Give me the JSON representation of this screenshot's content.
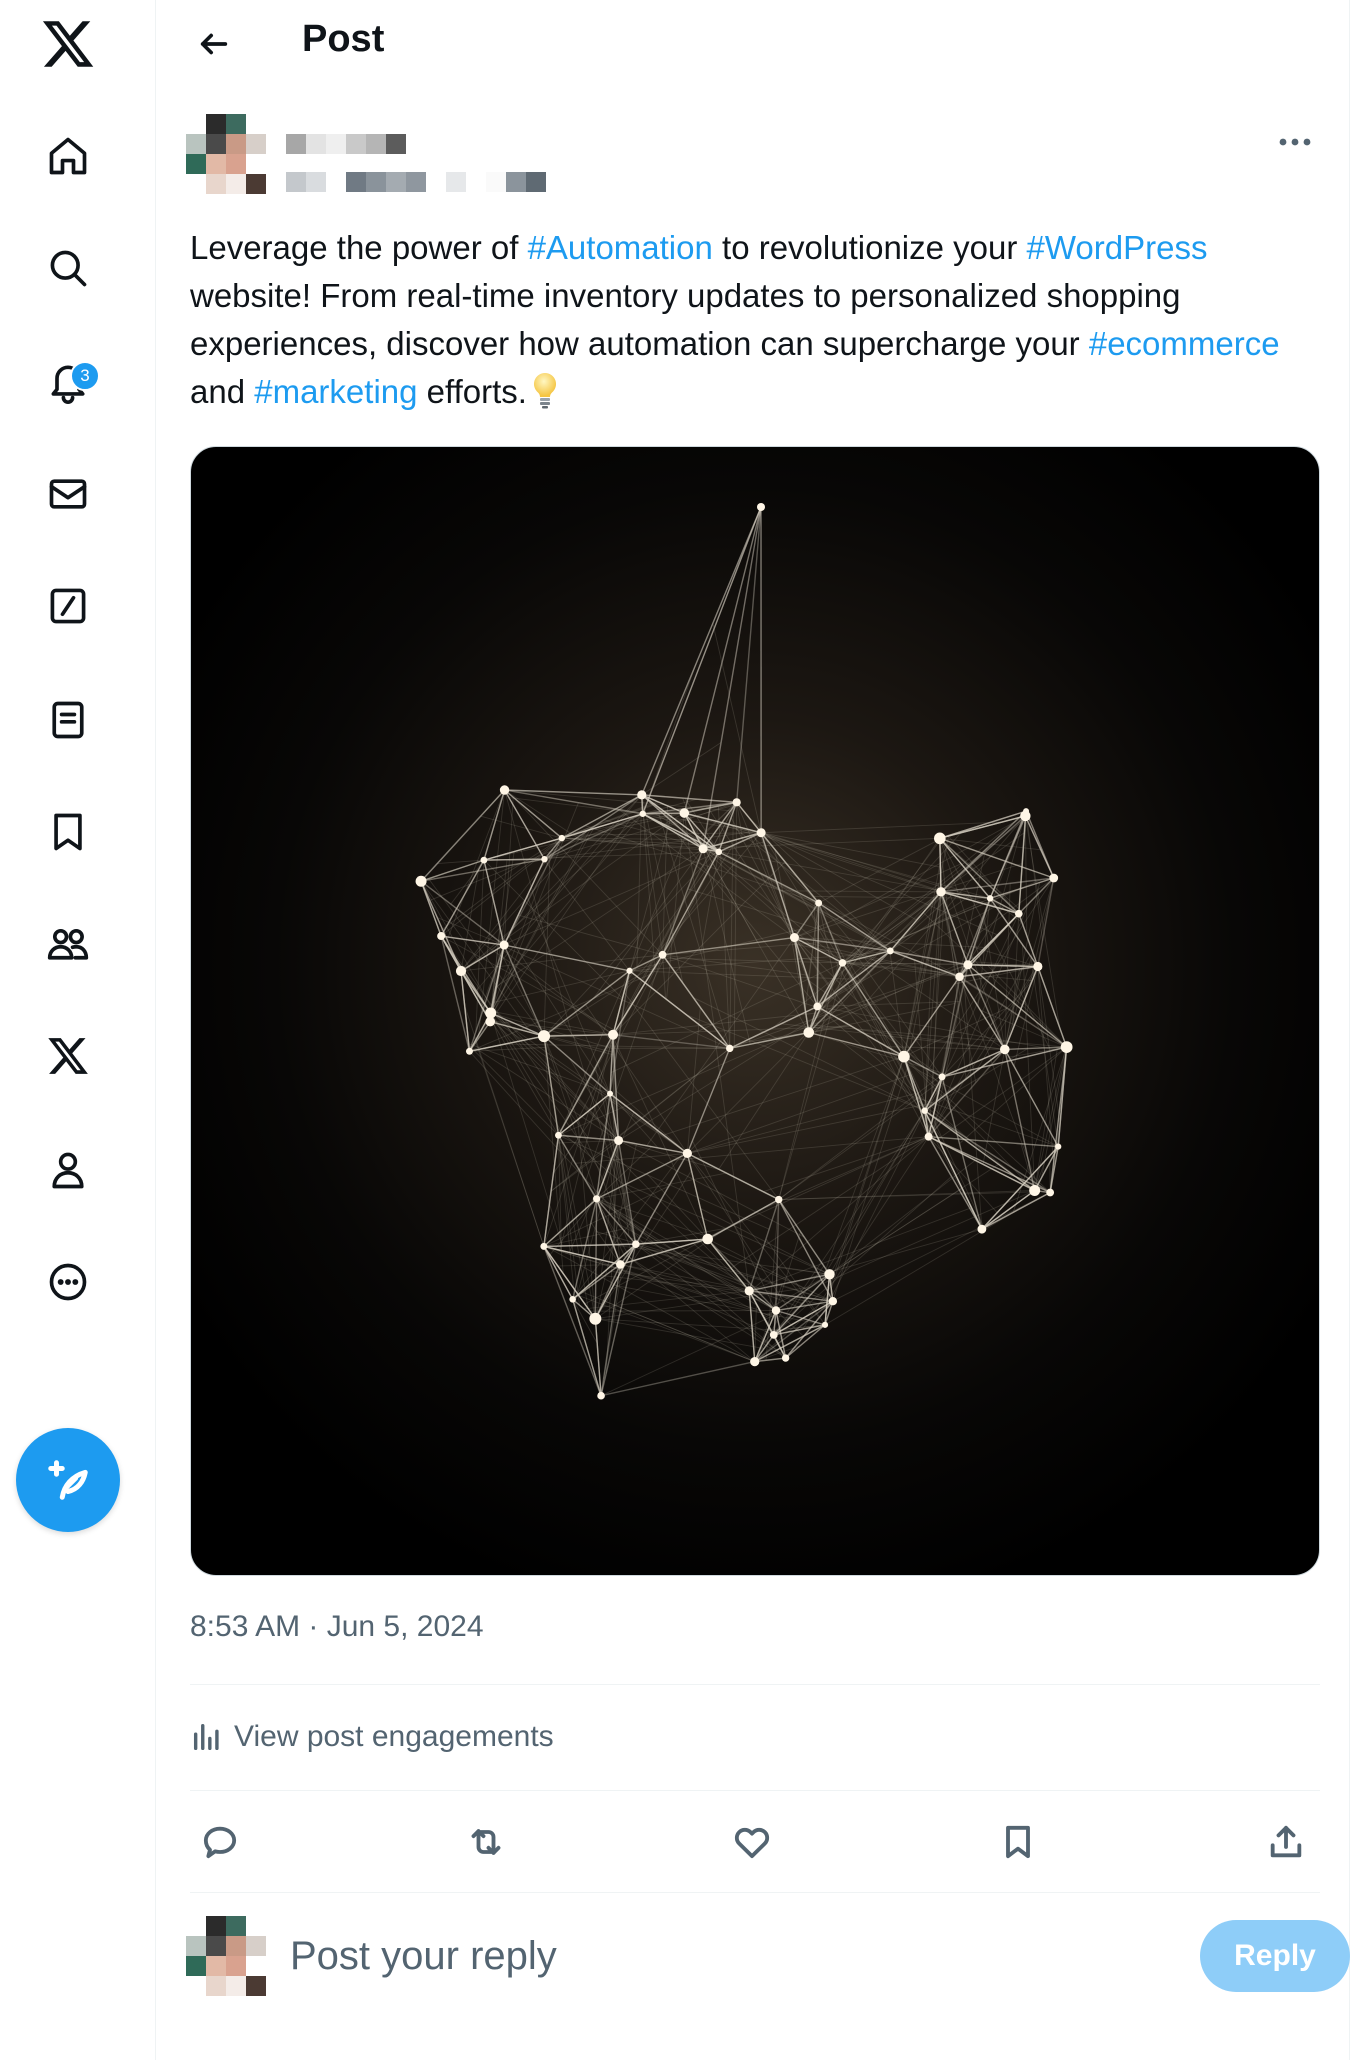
{
  "sidebar": {
    "logo_icon": "x-logo-icon",
    "items": [
      {
        "id": "home",
        "icon": "home-icon"
      },
      {
        "id": "explore",
        "icon": "search-icon"
      },
      {
        "id": "notifications",
        "icon": "bell-icon",
        "badge": "3"
      },
      {
        "id": "messages",
        "icon": "envelope-icon"
      },
      {
        "id": "grok",
        "icon": "slash-square-icon"
      },
      {
        "id": "lists",
        "icon": "list-icon"
      },
      {
        "id": "bookmarks",
        "icon": "bookmark-icon"
      },
      {
        "id": "communities",
        "icon": "people-icon"
      },
      {
        "id": "premium",
        "icon": "x-icon"
      },
      {
        "id": "profile",
        "icon": "person-icon"
      },
      {
        "id": "more",
        "icon": "more-circle-icon"
      }
    ],
    "compose_icon": "feather-plus-icon"
  },
  "header": {
    "title": "Post",
    "back_icon": "arrow-left-icon"
  },
  "post": {
    "text": {
      "part1": "Leverage the power of ",
      "tag1": "#Automation",
      "part2": " to revolutionize your ",
      "tag2": "#WordPress",
      "part3": " website! From real-time inventory updates to personalized shopping experiences, discover how automation can supercharge your ",
      "tag3": "#ecommerce",
      "part4": " and ",
      "tag4": "#marketing",
      "part5": " efforts."
    },
    "emoji_icon": "lightbulb-icon",
    "timestamp": "8:53 AM · Jun 5, 2024",
    "engagements_label": "View post engagements",
    "engagements_icon": "bar-chart-icon",
    "actions": [
      "reply-icon",
      "repost-icon",
      "like-icon",
      "bookmark-icon",
      "share-icon"
    ]
  },
  "reply": {
    "placeholder": "Post your reply",
    "button_label": "Reply"
  },
  "colors": {
    "accent": "#1d9bf0",
    "reply_button_disabled": "#8ecdf8",
    "text_primary": "#0f1419",
    "text_secondary": "#536471"
  }
}
